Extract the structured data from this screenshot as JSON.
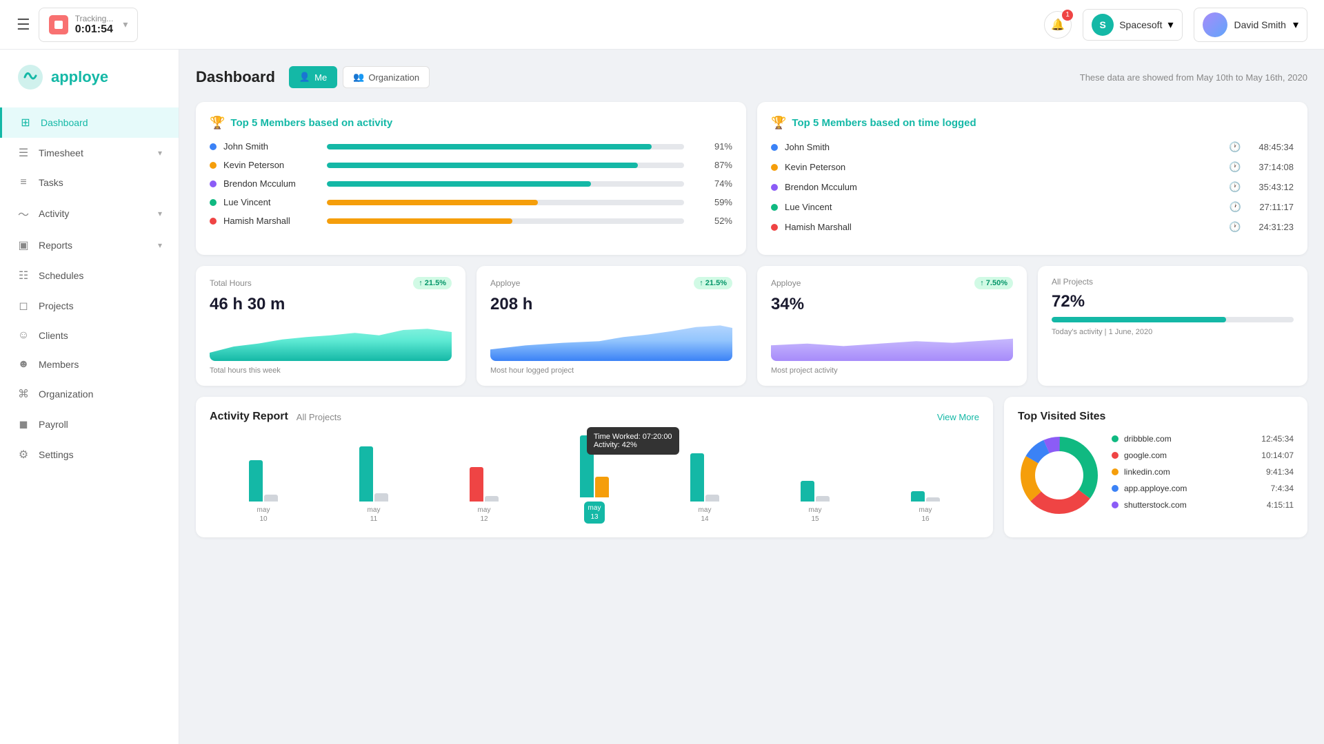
{
  "topnav": {
    "hamburger": "☰",
    "tracking_label": "Tracking...",
    "tracking_time": "0:01:54",
    "notifications_count": "1",
    "org_initial": "S",
    "org_name": "Spacesoft",
    "user_name": "David Smith"
  },
  "sidebar": {
    "logo_text": "apploye",
    "items": [
      {
        "label": "Dashboard",
        "icon": "⊞",
        "active": true
      },
      {
        "label": "Timesheet",
        "icon": "☰",
        "has_chevron": true
      },
      {
        "label": "Tasks",
        "icon": "≡"
      },
      {
        "label": "Activity",
        "icon": "〜",
        "has_chevron": true
      },
      {
        "label": "Reports",
        "icon": "▣",
        "has_chevron": true
      },
      {
        "label": "Schedules",
        "icon": "☷"
      },
      {
        "label": "Projects",
        "icon": "◻"
      },
      {
        "label": "Clients",
        "icon": "☺"
      },
      {
        "label": "Members",
        "icon": "☻"
      },
      {
        "label": "Organization",
        "icon": "⌘"
      },
      {
        "label": "Payroll",
        "icon": "◼"
      },
      {
        "label": "Settings",
        "icon": "⚙"
      }
    ]
  },
  "dashboard": {
    "title": "Dashboard",
    "tab_me": "Me",
    "tab_org": "Organization",
    "date_range": "These data are showed from May 10th to May 16th, 2020"
  },
  "top_activity": {
    "title": "Top 5 Members based on activity",
    "members": [
      {
        "name": "John Smith",
        "color": "#3b82f6",
        "value": "91%",
        "pct": 91,
        "bar_color": "#14b8a6"
      },
      {
        "name": "Kevin Peterson",
        "color": "#f59e0b",
        "value": "87%",
        "pct": 87,
        "bar_color": "#14b8a6"
      },
      {
        "name": "Brendon Mcculum",
        "color": "#8b5cf6",
        "value": "74%",
        "pct": 74,
        "bar_color": "#14b8a6"
      },
      {
        "name": "Lue Vincent",
        "color": "#10b981",
        "value": "59%",
        "pct": 59,
        "bar_color": "#f59e0b"
      },
      {
        "name": "Hamish Marshall",
        "color": "#ef4444",
        "value": "52%",
        "pct": 52,
        "bar_color": "#f59e0b"
      }
    ]
  },
  "top_time": {
    "title": "Top 5 Members based on time logged",
    "members": [
      {
        "name": "John Smith",
        "color": "#3b82f6",
        "value": "48:45:34"
      },
      {
        "name": "Kevin Peterson",
        "color": "#f59e0b",
        "value": "37:14:08"
      },
      {
        "name": "Brendon Mcculum",
        "color": "#8b5cf6",
        "value": "35:43:12"
      },
      {
        "name": "Lue Vincent",
        "color": "#10b981",
        "value": "27:11:17"
      },
      {
        "name": "Hamish Marshall",
        "color": "#ef4444",
        "value": "24:31:23"
      }
    ]
  },
  "stats": [
    {
      "label": "Total Hours",
      "badge": "↑ 21.5%",
      "value": "46 h 30 m",
      "sub": "Total hours this week",
      "chart": "teal"
    },
    {
      "label": "Apploye",
      "badge": "↑ 21.5%",
      "value": "208 h",
      "sub": "Most hour logged project",
      "chart": "blue"
    },
    {
      "label": "Apploye",
      "badge": "↑ 7.50%",
      "value": "34%",
      "sub": "Most project activity",
      "chart": "purple"
    },
    {
      "label": "All Projects",
      "badge": "",
      "value": "72%",
      "sub": "Today's activity | 1 June, 2020",
      "chart": "progress"
    }
  ],
  "activity_report": {
    "title": "Activity Report",
    "sub": "All Projects",
    "view_more": "View More",
    "tooltip_time": "Time Worked: 07:20:00",
    "tooltip_activity": "Activity: 42%",
    "bars": [
      {
        "date": "may\n10",
        "teal_h": 60,
        "gray_h": 10,
        "active": false
      },
      {
        "date": "may\n11",
        "teal_h": 80,
        "gray_h": 12,
        "active": false
      },
      {
        "date": "may\n12",
        "teal_h": 0,
        "red_h": 50,
        "gray_h": 8,
        "active": false
      },
      {
        "date": "may\n13",
        "teal_h": 90,
        "yellow_h": 20,
        "gray_h": 10,
        "active": true
      },
      {
        "date": "may\n14",
        "teal_h": 70,
        "gray_h": 10,
        "active": false
      },
      {
        "date": "may\n15",
        "teal_h": 30,
        "gray_h": 8,
        "active": false
      },
      {
        "date": "may\n16",
        "teal_h": 15,
        "gray_h": 6,
        "active": false
      }
    ]
  },
  "top_visited": {
    "title": "Top Visited Sites",
    "sites": [
      {
        "name": "dribbble.com",
        "color": "#10b981",
        "time": "12:45:34",
        "pct": 35
      },
      {
        "name": "google.com",
        "color": "#ef4444",
        "time": "10:14:07",
        "pct": 28
      },
      {
        "name": "linkedin.com",
        "color": "#f59e0b",
        "time": "9:41:34",
        "pct": 20
      },
      {
        "name": "app.apploye.com",
        "color": "#3b82f6",
        "time": "7:4:34",
        "pct": 10
      },
      {
        "name": "shutterstock.com",
        "color": "#8b5cf6",
        "time": "4:15:11",
        "pct": 7
      }
    ]
  }
}
